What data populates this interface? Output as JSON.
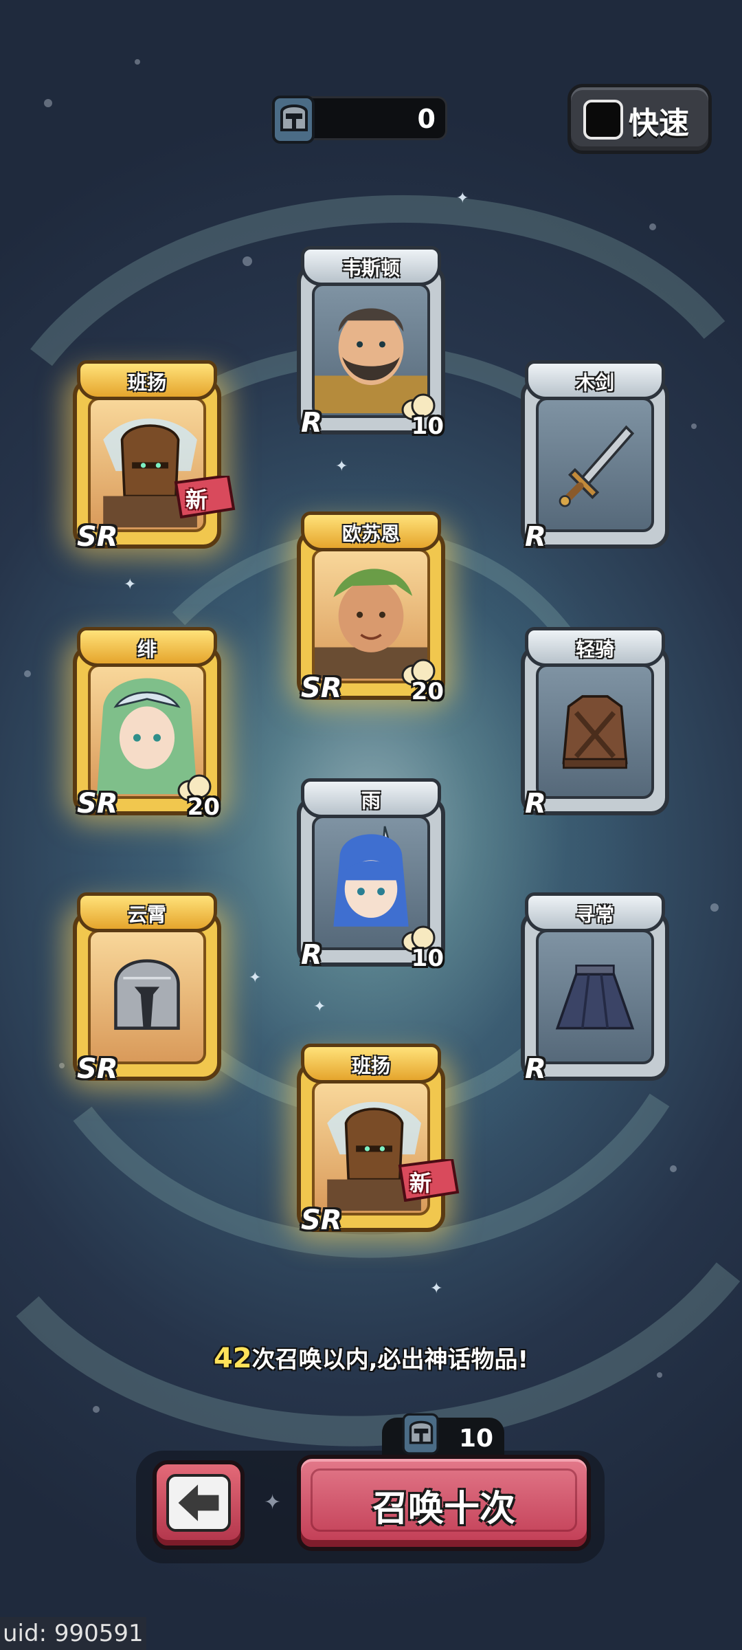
{
  "currency": {
    "icon": "helmet-ticket-icon",
    "count": "0"
  },
  "fast_toggle": {
    "label": "快速",
    "checked": false
  },
  "cards": [
    {
      "name": "韦斯顿",
      "rarity": "R",
      "quantity": "10",
      "kind": "hero",
      "is_new": false,
      "new_label": ""
    },
    {
      "name": "班扬",
      "rarity": "SR",
      "quantity": "",
      "kind": "hero",
      "is_new": true,
      "new_label": "新"
    },
    {
      "name": "木剑",
      "rarity": "R",
      "quantity": "",
      "kind": "item",
      "is_new": false,
      "new_label": ""
    },
    {
      "name": "欧苏恩",
      "rarity": "SR",
      "quantity": "20",
      "kind": "hero",
      "is_new": false,
      "new_label": ""
    },
    {
      "name": "绯",
      "rarity": "SR",
      "quantity": "20",
      "kind": "hero",
      "is_new": false,
      "new_label": ""
    },
    {
      "name": "轻骑",
      "rarity": "R",
      "quantity": "",
      "kind": "item",
      "is_new": false,
      "new_label": ""
    },
    {
      "name": "雨",
      "rarity": "R",
      "quantity": "10",
      "kind": "hero",
      "is_new": false,
      "new_label": ""
    },
    {
      "name": "云霄",
      "rarity": "SR",
      "quantity": "",
      "kind": "item",
      "is_new": false,
      "new_label": ""
    },
    {
      "name": "寻常",
      "rarity": "R",
      "quantity": "",
      "kind": "item",
      "is_new": false,
      "new_label": ""
    },
    {
      "name": "班扬",
      "rarity": "SR",
      "quantity": "",
      "kind": "hero",
      "is_new": true,
      "new_label": "新"
    }
  ],
  "pity": {
    "count": "42",
    "text": "次召唤以内,必出神话物品!"
  },
  "summon": {
    "cost": "10",
    "label": "召唤十次",
    "back_icon": "back-arrow-icon"
  },
  "uid": "uid: 990591",
  "colors": {
    "sr_gold": "#f1c74e",
    "r_silver": "#c4ccd2",
    "button_red": "#c13c54",
    "pity_highlight": "#ffe25a"
  }
}
